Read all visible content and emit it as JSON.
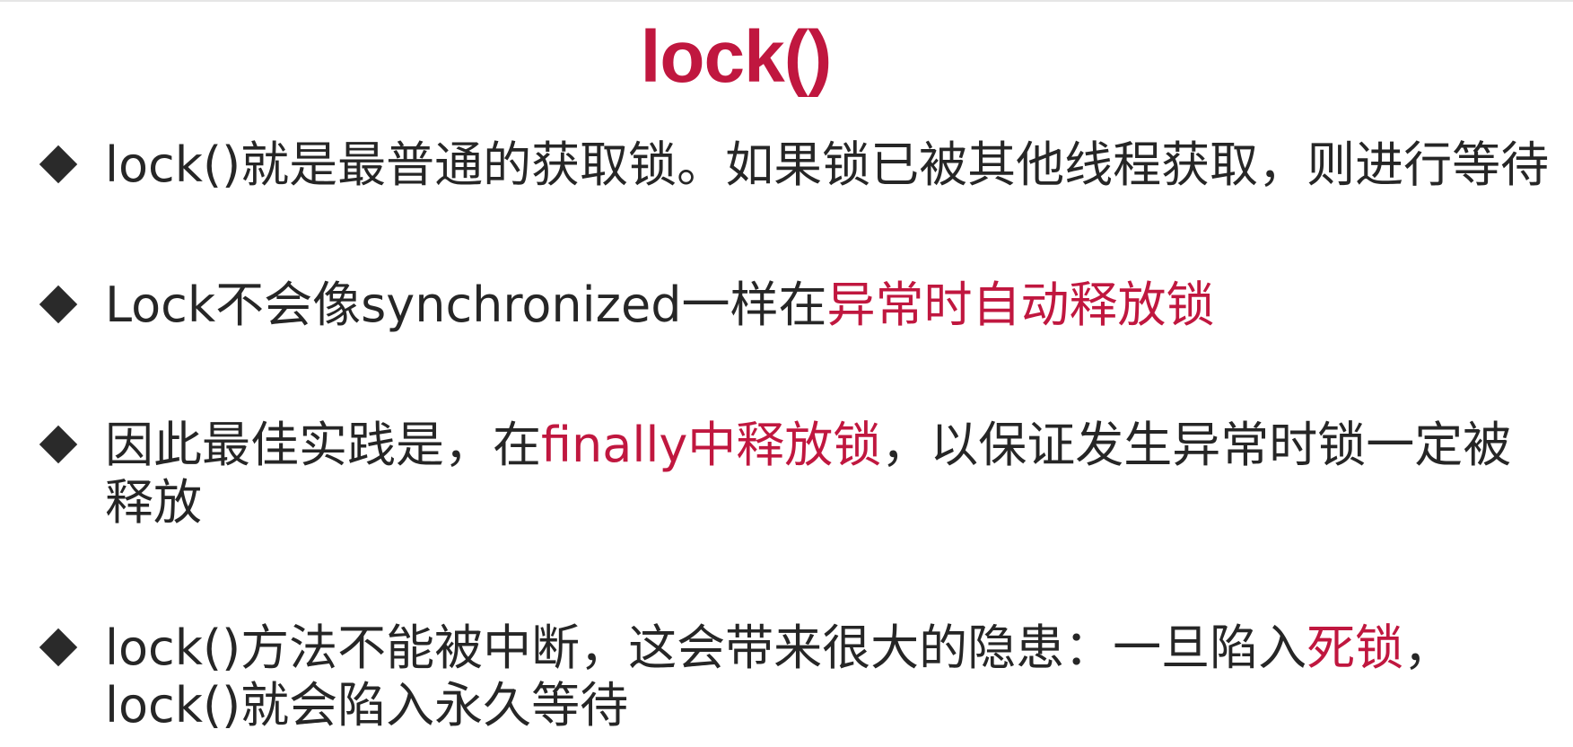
{
  "title": "lock()",
  "bullets": [
    {
      "segments": [
        {
          "text": "lock()就是最普通的获取锁。如果锁已被其他线程获取，则进行等待",
          "highlight": false
        }
      ]
    },
    {
      "segments": [
        {
          "text": "Lock不会像synchronized一样在",
          "highlight": false
        },
        {
          "text": "异常时自动释放锁",
          "highlight": true
        }
      ]
    },
    {
      "segments": [
        {
          "text": "因此最佳实践是，在",
          "highlight": false
        },
        {
          "text": "finally中释放锁",
          "highlight": true
        },
        {
          "text": "，以保证发生异常时锁一定被释放",
          "highlight": false
        }
      ]
    },
    {
      "segments": [
        {
          "text": "lock()方法不能被中断，这会带来很大的隐患：一旦陷入",
          "highlight": false
        },
        {
          "text": "死锁",
          "highlight": true
        },
        {
          "text": "，lock()就会陷入永久等待",
          "highlight": false
        }
      ]
    }
  ],
  "colors": {
    "accent": "#c0173f",
    "text": "#262626",
    "marker": "#2a2a2a"
  },
  "icons": {
    "bullet_marker": "diamond-bullet-icon"
  }
}
